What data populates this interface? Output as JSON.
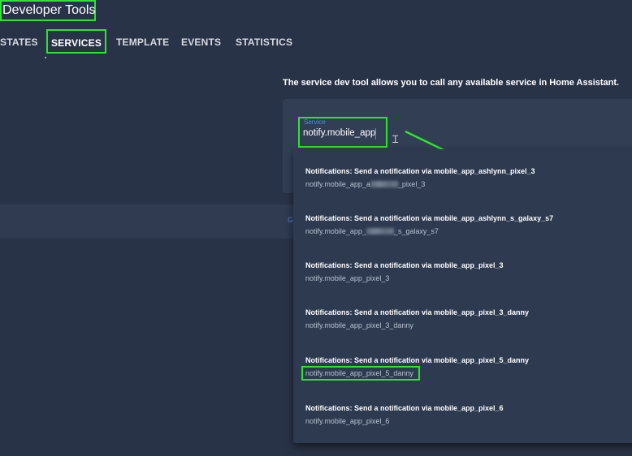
{
  "header": {
    "title": "Developer Tools"
  },
  "tabs": [
    {
      "label": "STATES"
    },
    {
      "label": "SERVICES"
    },
    {
      "label": "TEMPLATE"
    },
    {
      "label": "EVENTS"
    },
    {
      "label": "STATISTICS"
    }
  ],
  "active_tab": "SERVICES",
  "description": "The service dev tool allows you to call any available service in Home Assistant.",
  "service_field": {
    "label": "Service",
    "value": "notify.mobile_app"
  },
  "strip_link": "G",
  "dropdown": {
    "items": [
      {
        "title": "Notifications: Send a notification via mobile_app_ashlynn_pixel_3",
        "sub_prefix": "notify.mobile_app_a",
        "sub_suffix": "_pixel_3",
        "redacted": true
      },
      {
        "title": "Notifications: Send a notification via mobile_app_ashlynn_s_galaxy_s7",
        "sub_prefix": "notify.mobile_app_",
        "sub_suffix": "_s_galaxy_s7",
        "redacted": true
      },
      {
        "title": "Notifications: Send a notification via mobile_app_pixel_3",
        "sub_prefix": "notify.mobile_app_pixel_3",
        "sub_suffix": "",
        "redacted": false
      },
      {
        "title": "Notifications: Send a notification via mobile_app_pixel_3_danny",
        "sub_prefix": "notify.mobile_app_pixel_3_danny",
        "sub_suffix": "",
        "redacted": false
      },
      {
        "title": "Notifications: Send a notification via mobile_app_pixel_5_danny",
        "sub_prefix": "notify.mobile_app_pixel_5_danny",
        "sub_suffix": "",
        "redacted": false
      },
      {
        "title": "Notifications: Send a notification via mobile_app_pixel_6",
        "sub_prefix": "notify.mobile_app_pixel_6",
        "sub_suffix": "",
        "redacted": false
      }
    ]
  },
  "colors": {
    "highlight": "#2ee52e",
    "accent": "#4a8fe0",
    "background": "#293348"
  }
}
